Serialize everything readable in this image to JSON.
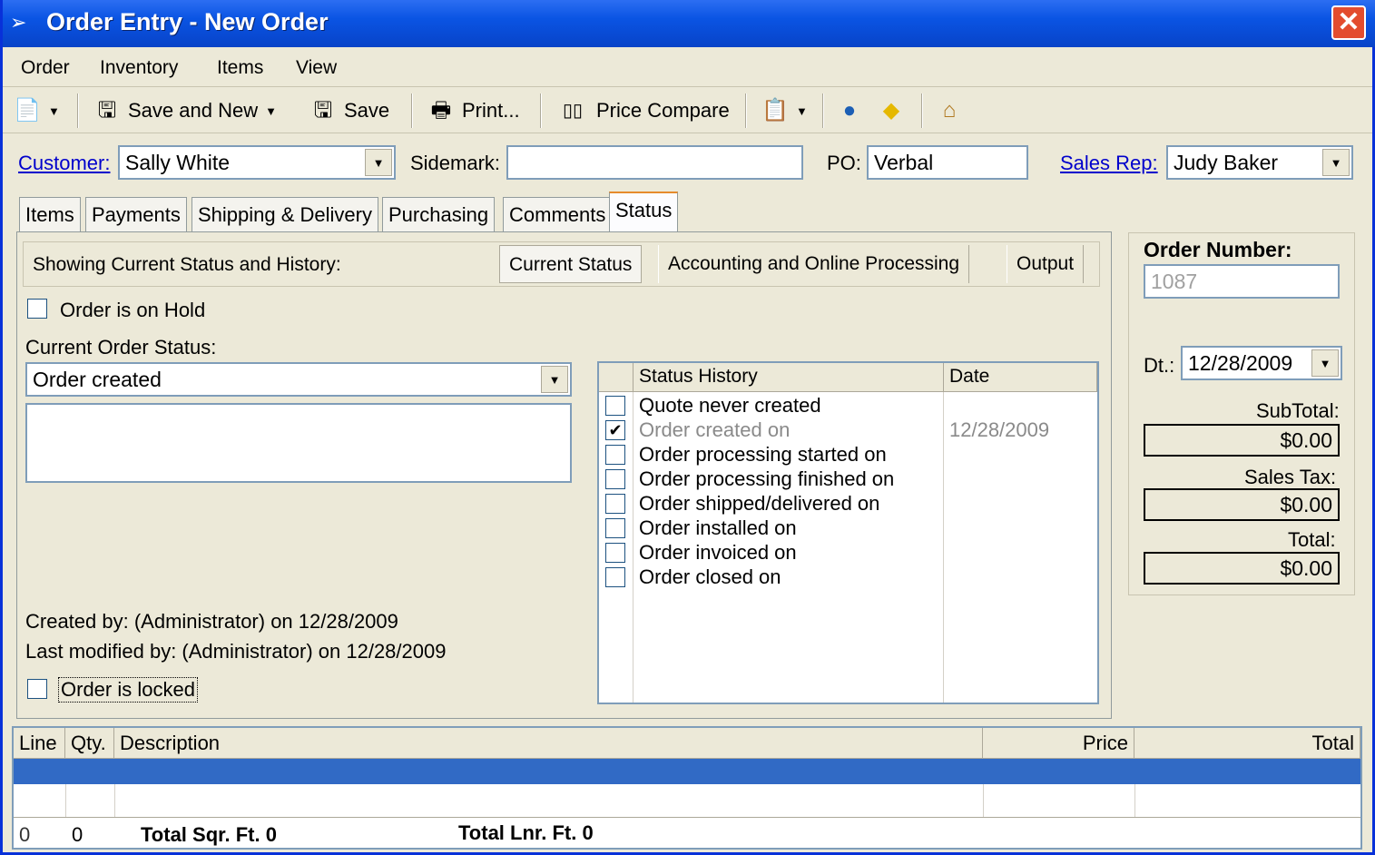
{
  "window": {
    "title": "Order Entry - New Order",
    "close_symbol": "✕"
  },
  "menu": [
    "Order",
    "Inventory",
    "Items",
    "View"
  ],
  "toolbar": {
    "save_and_new": "Save and New",
    "save": "Save",
    "print": "Print...",
    "price_compare": "Price Compare"
  },
  "header": {
    "customer_label": "Customer:",
    "customer_value": "Sally White",
    "sidemark_label": "Sidemark:",
    "sidemark_value": "",
    "po_label": "PO:",
    "po_value": "Verbal",
    "sales_rep_label": "Sales Rep:",
    "sales_rep_value": "Judy Baker"
  },
  "tabs": [
    "Items",
    "Payments",
    "Shipping & Delivery",
    "Purchasing",
    "Comments",
    "Status"
  ],
  "active_tab": "Status",
  "status": {
    "showing_label": "Showing Current Status and History:",
    "subtabs": [
      "Current Status",
      "Accounting and Online Processing",
      "Output"
    ],
    "on_hold_label": "Order is on Hold",
    "current_status_label": "Current Order Status:",
    "current_status_value": "Order created",
    "notes": "",
    "created_by": "Created by: (Administrator) on 12/28/2009",
    "modified_by": "Last modified by: (Administrator) on 12/28/2009",
    "locked_label": "Order is locked"
  },
  "history": {
    "col_status": "Status History",
    "col_date": "Date",
    "rows": [
      {
        "label": "Quote never created",
        "checked": false,
        "date": ""
      },
      {
        "label": "Order created on",
        "checked": true,
        "date": "12/28/2009"
      },
      {
        "label": "Order processing started on",
        "checked": false,
        "date": ""
      },
      {
        "label": "Order processing finished on",
        "checked": false,
        "date": ""
      },
      {
        "label": "Order shipped/delivered on",
        "checked": false,
        "date": ""
      },
      {
        "label": "Order installed on",
        "checked": false,
        "date": ""
      },
      {
        "label": "Order invoiced on",
        "checked": false,
        "date": ""
      },
      {
        "label": "Order closed on",
        "checked": false,
        "date": ""
      }
    ]
  },
  "summary": {
    "order_number_label": "Order Number:",
    "order_number": "1087",
    "date_label": "Dt.:",
    "date_value": "12/28/2009",
    "subtotal_label": "SubTotal:",
    "subtotal": "$0.00",
    "sales_tax_label": "Sales Tax:",
    "sales_tax": "$0.00",
    "total_label": "Total:",
    "total": "$0.00"
  },
  "lines": {
    "col_line": "Line",
    "col_qty": "Qty.",
    "col_desc": "Description",
    "col_price": "Price",
    "col_total": "Total",
    "footer_line": "0",
    "footer_qty": "0",
    "total_sqft": "Total Sqr. Ft. 0",
    "total_lnrft": "Total Lnr. Ft. 0"
  }
}
